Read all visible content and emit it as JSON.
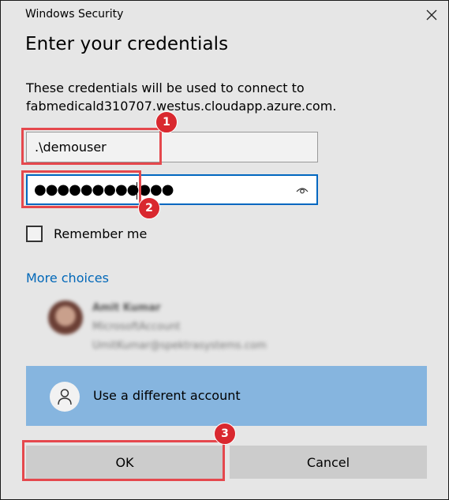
{
  "window": {
    "title": "Windows Security",
    "close_icon": "close-icon"
  },
  "heading": "Enter your credentials",
  "description": {
    "line1": "These credentials will be used to connect to",
    "line2": "fabmedicald310707.westus.cloudapp.azure.com."
  },
  "username": {
    "value": ".\\demouser"
  },
  "password": {
    "masked_value": "●●●●●●●●●●●●",
    "reveal_icon": "eye-icon"
  },
  "remember": {
    "label": "Remember me",
    "checked": false
  },
  "more_choices": {
    "label": "More choices"
  },
  "saved_account": {
    "name": "Amit Kumar",
    "type": "MicrosoftAccount",
    "email": "UmitKumar@spektrasystems.com",
    "avatar": "user-avatar"
  },
  "different_account": {
    "label": "Use a different account",
    "icon": "person-icon",
    "highlight_color": "#86b5df"
  },
  "buttons": {
    "ok": "OK",
    "cancel": "Cancel"
  },
  "annotations": {
    "color": "#d9282f",
    "steps": [
      "1",
      "2",
      "3"
    ]
  }
}
